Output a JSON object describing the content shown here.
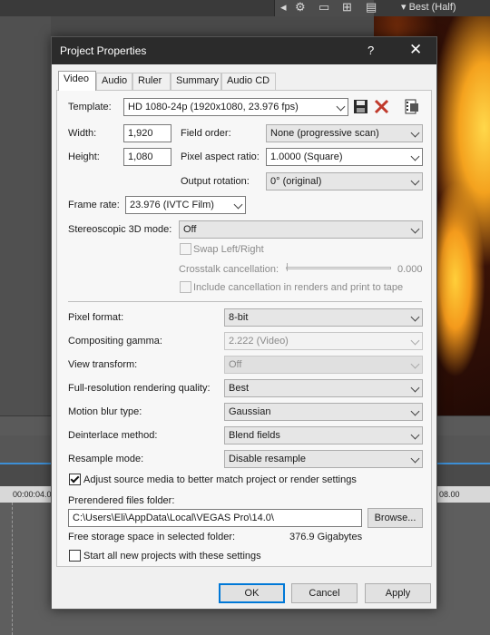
{
  "background": {
    "preview_quality": "Best (Half)",
    "ruler_times": [
      "00:00:04.0",
      "08.00"
    ]
  },
  "dialog": {
    "title": "Project Properties",
    "help_symbol": "?",
    "close_symbol": "✕",
    "tabs": [
      {
        "label": "Video",
        "active": true
      },
      {
        "label": "Audio",
        "active": false
      },
      {
        "label": "Ruler",
        "active": false
      },
      {
        "label": "Summary",
        "active": false
      },
      {
        "label": "Audio CD",
        "active": false
      }
    ]
  },
  "video": {
    "template_label": "Template:",
    "template_value": "HD 1080-24p (1920x1080, 23.976 fps)",
    "width_label": "Width:",
    "width_value": "1,920",
    "height_label": "Height:",
    "height_value": "1,080",
    "field_order_label": "Field order:",
    "field_order_value": "None (progressive scan)",
    "pixel_aspect_label": "Pixel aspect ratio:",
    "pixel_aspect_value": "1.0000 (Square)",
    "output_rotation_label": "Output rotation:",
    "output_rotation_value": "0° (original)",
    "frame_rate_label": "Frame rate:",
    "frame_rate_value": "23.976 (IVTC Film)",
    "stereo_label": "Stereoscopic 3D mode:",
    "stereo_value": "Off",
    "swap_label": "Swap Left/Right",
    "crosstalk_label": "Crosstalk cancellation:",
    "crosstalk_value": "0.000",
    "include_cancel_label": "Include cancellation in renders and print to tape",
    "pixel_format_label": "Pixel format:",
    "pixel_format_value": "8-bit",
    "compositing_label": "Compositing gamma:",
    "compositing_value": "2.222 (Video)",
    "view_transform_label": "View transform:",
    "view_transform_value": "Off",
    "fullres_label": "Full-resolution rendering quality:",
    "fullres_value": "Best",
    "motion_blur_label": "Motion blur type:",
    "motion_blur_value": "Gaussian",
    "deinterlace_label": "Deinterlace method:",
    "deinterlace_value": "Blend fields",
    "resample_label": "Resample mode:",
    "resample_value": "Disable resample",
    "adjust_label": "Adjust source media to better match project or render settings",
    "adjust_checked": true,
    "prerendered_label": "Prerendered files folder:",
    "prerendered_value": "C:\\Users\\Eli\\AppData\\Local\\VEGAS Pro\\14.0\\",
    "browse_label": "Browse...",
    "free_space_label": "Free storage space in selected folder:",
    "free_space_value": "376.9 Gigabytes",
    "start_all_label": "Start all new projects with these settings",
    "start_all_checked": false
  },
  "buttons": {
    "ok": "OK",
    "cancel": "Cancel",
    "apply": "Apply"
  },
  "colors": {
    "titlebar": "#2b2b2b",
    "accent": "#0078d7",
    "delete_icon": "#c0392b"
  }
}
